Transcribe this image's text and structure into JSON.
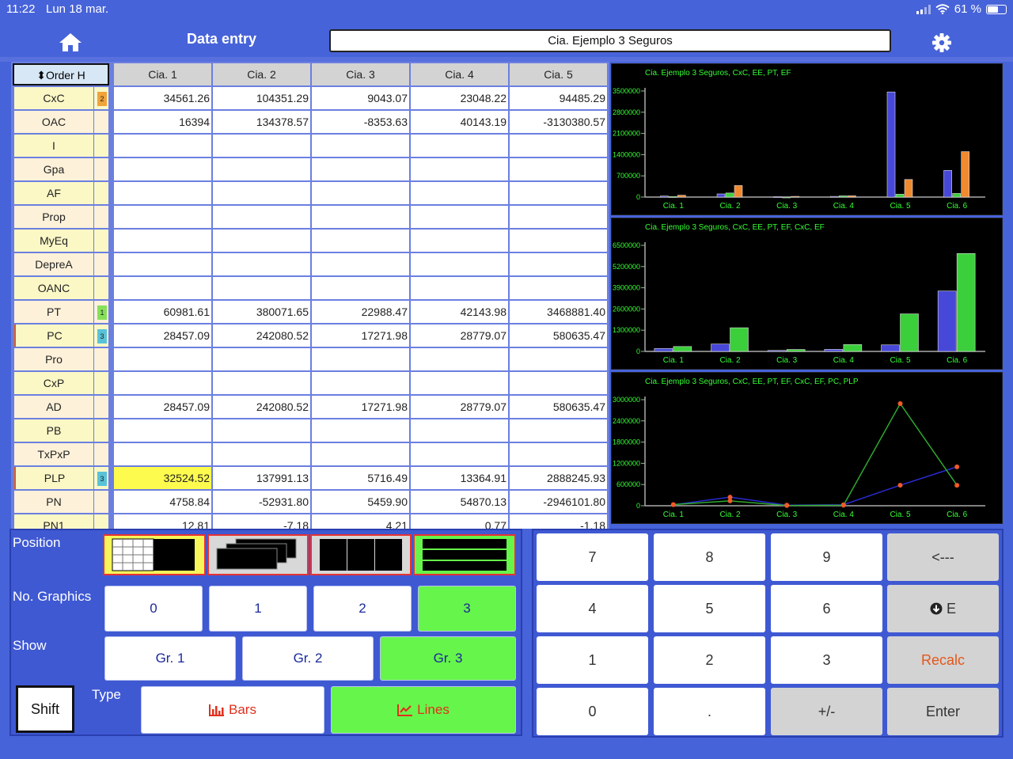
{
  "status_bar": {
    "time": "11:22",
    "date": "Lun 18 mar.",
    "battery": "61 %"
  },
  "header": {
    "title": "Data entry",
    "company": "Cia. Ejemplo 3 Seguros"
  },
  "grid": {
    "order_label": "Order H",
    "columns": [
      "Cia. 1",
      "Cia. 2",
      "Cia. 3",
      "Cia. 4",
      "Cia. 5"
    ],
    "rows": [
      {
        "label": "CxC",
        "order": "2",
        "values": [
          "34561.26",
          "104351.29",
          "9043.07",
          "23048.22",
          "94485.29"
        ]
      },
      {
        "label": "OAC",
        "order": "",
        "values": [
          "16394",
          "134378.57",
          "-8353.63",
          "40143.19",
          "-3130380.57"
        ]
      },
      {
        "label": "I",
        "order": "",
        "values": [
          "",
          "",
          "",
          "",
          ""
        ]
      },
      {
        "label": "Gpa",
        "order": "",
        "values": [
          "",
          "",
          "",
          "",
          ""
        ]
      },
      {
        "label": "AF",
        "order": "",
        "values": [
          "",
          "",
          "",
          "",
          ""
        ]
      },
      {
        "label": "Prop",
        "order": "",
        "values": [
          "",
          "",
          "",
          "",
          ""
        ]
      },
      {
        "label": "MyEq",
        "order": "",
        "values": [
          "",
          "",
          "",
          "",
          ""
        ]
      },
      {
        "label": "DepreA",
        "order": "",
        "values": [
          "",
          "",
          "",
          "",
          ""
        ]
      },
      {
        "label": "OANC",
        "order": "",
        "values": [
          "",
          "",
          "",
          "",
          ""
        ]
      },
      {
        "label": "PT",
        "order": "1",
        "values": [
          "60981.61",
          "380071.65",
          "22988.47",
          "42143.98",
          "3468881.40"
        ]
      },
      {
        "label": "PC",
        "order": "3",
        "values": [
          "28457.09",
          "242080.52",
          "17271.98",
          "28779.07",
          "580635.47"
        ]
      },
      {
        "label": "Pro",
        "order": "",
        "values": [
          "",
          "",
          "",
          "",
          ""
        ]
      },
      {
        "label": "CxP",
        "order": "",
        "values": [
          "",
          "",
          "",
          "",
          ""
        ]
      },
      {
        "label": "AD",
        "order": "",
        "values": [
          "28457.09",
          "242080.52",
          "17271.98",
          "28779.07",
          "580635.47"
        ]
      },
      {
        "label": "PB",
        "order": "",
        "values": [
          "",
          "",
          "",
          "",
          ""
        ]
      },
      {
        "label": "TxPxP",
        "order": "",
        "values": [
          "",
          "",
          "",
          "",
          ""
        ]
      },
      {
        "label": "PLP",
        "order": "3",
        "values": [
          "32524.52",
          "137991.13",
          "5716.49",
          "13364.91",
          "2888245.93"
        ]
      },
      {
        "label": "PN",
        "order": "",
        "values": [
          "4758.84",
          "-52931.80",
          "5459.90",
          "54870.13",
          "-2946101.80"
        ]
      },
      {
        "label": "PN1",
        "order": "",
        "values": [
          "12.81",
          "-7.18",
          "4.21",
          "0.77",
          "-1.18"
        ]
      }
    ]
  },
  "charts": [
    {
      "title": "Cia. Ejemplo 3 Seguros, CxC, EE, PT, EF",
      "yticks": [
        "0",
        "700000",
        "1400000",
        "2100000",
        "2800000",
        "3500000"
      ]
    },
    {
      "title": "Cia. Ejemplo 3 Seguros, CxC, EE, PT, EF, CxC, EF",
      "yticks": [
        "0",
        "1300000",
        "2600000",
        "3900000",
        "5200000",
        "6500000"
      ]
    },
    {
      "title": "Cia. Ejemplo 3 Seguros, CxC, EE, PT, EF, CxC, EF, PC, PLP",
      "yticks": [
        "0",
        "600000",
        "1200000",
        "1800000",
        "2400000",
        "3000000"
      ]
    }
  ],
  "chart_data": [
    {
      "type": "bar",
      "title": "Cia. Ejemplo 3 Seguros, CxC, EE, PT, EF",
      "categories": [
        "Cia. 1",
        "Cia. 2",
        "Cia. 3",
        "Cia. 4",
        "Cia. 5",
        "Cia. 6"
      ],
      "ylim": [
        0,
        3500000
      ],
      "series": [
        {
          "name": "",
          "color": "#4848d8",
          "values": [
            34561,
            104351,
            9043,
            23048,
            3468881,
            880000
          ]
        },
        {
          "name": "",
          "color": "#3ccf3c",
          "values": [
            16394,
            134378,
            0,
            40143,
            94485,
            120000
          ]
        },
        {
          "name": "",
          "color": "#f08a30",
          "values": [
            60981,
            380071,
            22988,
            42143,
            580635,
            1500000
          ]
        }
      ]
    },
    {
      "type": "bar",
      "title": "Cia. Ejemplo 3 Seguros, CxC, EE, PT, EF, CxC, EF",
      "categories": [
        "Cia. 1",
        "Cia. 2",
        "Cia. 3",
        "Cia. 4",
        "Cia. 5",
        "Cia. 6"
      ],
      "ylim": [
        0,
        6500000
      ],
      "series": [
        {
          "name": "",
          "color": "#4848d8",
          "values": [
            180000,
            450000,
            60000,
            130000,
            400000,
            3700000
          ]
        },
        {
          "name": "",
          "color": "#3ccf3c",
          "values": [
            300000,
            1450000,
            120000,
            420000,
            2300000,
            6000000
          ]
        }
      ]
    },
    {
      "type": "line",
      "title": "Cia. Ejemplo 3 Seguros, CxC, EE, PT, EF, CxC, EF, PC, PLP",
      "categories": [
        "Cia. 1",
        "Cia. 2",
        "Cia. 3",
        "Cia. 4",
        "Cia. 5",
        "Cia. 6"
      ],
      "ylim": [
        0,
        3000000
      ],
      "series": [
        {
          "name": "",
          "color": "#2a2ad0",
          "values": [
            28457,
            242080,
            17271,
            28779,
            580635,
            1100000
          ]
        },
        {
          "name": "",
          "color": "#2ea82e",
          "values": [
            32524,
            137991,
            5716,
            13364,
            2888245,
            580000
          ]
        }
      ]
    }
  ],
  "position": {
    "label": "Position"
  },
  "graphics": {
    "label": "No. Graphics",
    "options": [
      "0",
      "1",
      "2",
      "3"
    ],
    "selected": "3"
  },
  "show": {
    "label": "Show",
    "options": [
      "Gr. 1",
      "Gr. 2",
      "Gr. 3"
    ],
    "selected": "Gr. 3"
  },
  "type": {
    "label": "Type",
    "bars": "Bars",
    "lines": "Lines",
    "selected": "Lines"
  },
  "shift": "Shift",
  "keypad": {
    "k7": "7",
    "k8": "8",
    "k9": "9",
    "back": "<---",
    "k4": "4",
    "k5": "5",
    "k6": "6",
    "exp": "E",
    "k1": "1",
    "k2": "2",
    "k3": "3",
    "recalc": "Recalc",
    "k0": "0",
    "dot": ".",
    "sign": "+/-",
    "enter": "Enter"
  }
}
